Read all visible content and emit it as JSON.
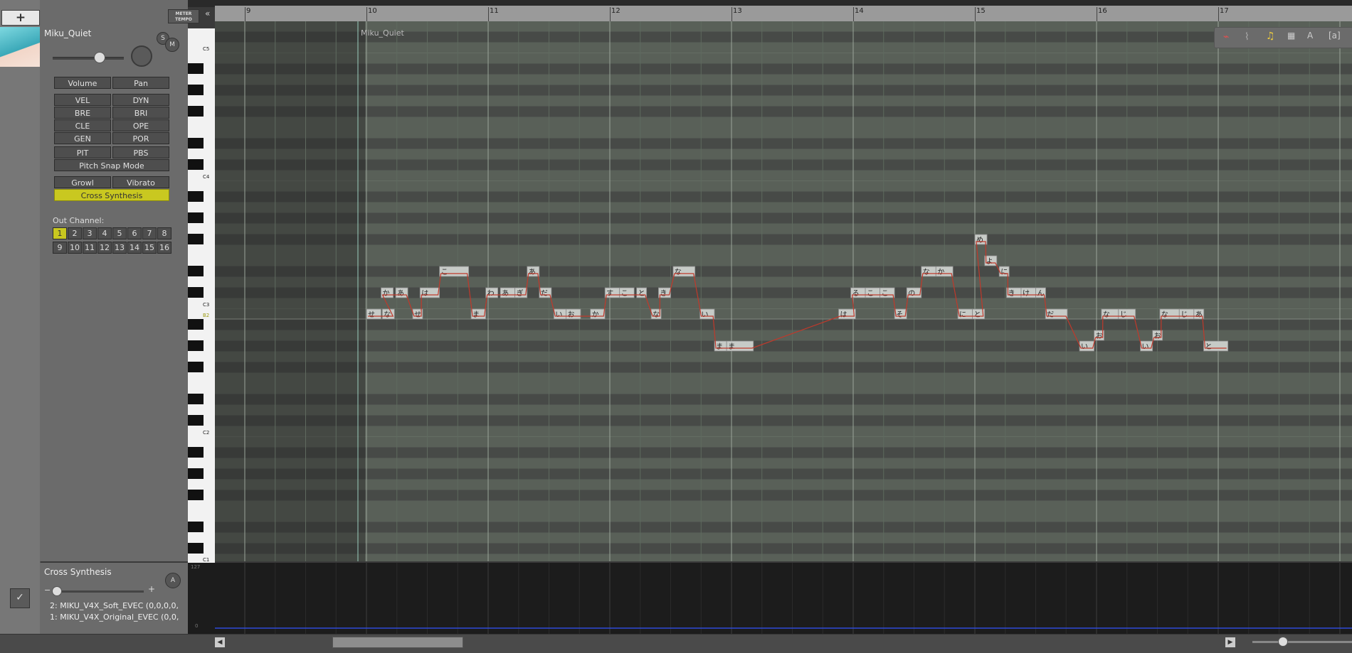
{
  "toolbar": {
    "add_label": "+",
    "meter_tempo": "METER TEMPO",
    "collapse": "«"
  },
  "track": {
    "name": "Miku_Quiet",
    "solo": "S",
    "mute": "M",
    "buttons": {
      "volume": "Volume",
      "pan": "Pan",
      "vel": "VEL",
      "dyn": "DYN",
      "bre": "BRE",
      "bri": "BRI",
      "cle": "CLE",
      "ope": "OPE",
      "gen": "GEN",
      "por": "POR",
      "pit": "PIT",
      "pbs": "PBS",
      "pitch_snap": "Pitch Snap Mode",
      "growl": "Growl",
      "vibrato": "Vibrato",
      "cross_synthesis": "Cross Synthesis"
    },
    "out_channel_label": "Out Channel:",
    "channels": [
      "1",
      "2",
      "3",
      "4",
      "5",
      "6",
      "7",
      "8",
      "9",
      "10",
      "11",
      "12",
      "13",
      "14",
      "15",
      "16"
    ],
    "selected_channel": "1"
  },
  "piano": {
    "labels": [
      "C5",
      "C4",
      "C3",
      "B2",
      "C2",
      "C1"
    ]
  },
  "ruler": {
    "bars": [
      "9",
      "10",
      "11",
      "12",
      "13",
      "14",
      "15",
      "16",
      "17"
    ]
  },
  "part": {
    "name": "Miku_Quiet"
  },
  "notes": [
    {
      "lyric": "せ",
      "pitch": "B2",
      "bar": 10.0,
      "len": 0.12
    },
    {
      "lyric": "な",
      "pitch": "B2",
      "bar": 10.13,
      "len": 0.1
    },
    {
      "lyric": "か",
      "pitch": "C#3",
      "bar": 10.12,
      "len": 0.1
    },
    {
      "lyric": "あ",
      "pitch": "C#3",
      "bar": 10.24,
      "len": 0.1
    },
    {
      "lyric": "せ",
      "pitch": "B2",
      "bar": 10.38,
      "len": 0.06
    },
    {
      "lyric": "は",
      "pitch": "C#3",
      "bar": 10.44,
      "len": 0.16
    },
    {
      "lyric": "こ",
      "pitch": "D#3",
      "bar": 10.6,
      "len": 0.24
    },
    {
      "lyric": "ま",
      "pitch": "B2",
      "bar": 10.86,
      "len": 0.12
    },
    {
      "lyric": "わ",
      "pitch": "C#3",
      "bar": 10.98,
      "len": 0.1
    },
    {
      "lyric": "あ",
      "pitch": "C#3",
      "bar": 11.1,
      "len": 0.12
    },
    {
      "lyric": "ぎ",
      "pitch": "C#3",
      "bar": 11.22,
      "len": 0.1
    },
    {
      "lyric": "あ",
      "pitch": "D#3",
      "bar": 11.32,
      "len": 0.1
    },
    {
      "lyric": "だ",
      "pitch": "C#3",
      "bar": 11.42,
      "len": 0.1
    },
    {
      "lyric": "い",
      "pitch": "B2",
      "bar": 11.54,
      "len": 0.1
    },
    {
      "lyric": "お",
      "pitch": "B2",
      "bar": 11.64,
      "len": 0.12
    },
    {
      "lyric": "か",
      "pitch": "B2",
      "bar": 11.84,
      "len": 0.12
    },
    {
      "lyric": "す",
      "pitch": "C#3",
      "bar": 11.96,
      "len": 0.12
    },
    {
      "lyric": "こ",
      "pitch": "C#3",
      "bar": 12.08,
      "len": 0.12
    },
    {
      "lyric": "と",
      "pitch": "C#3",
      "bar": 12.22,
      "len": 0.08
    },
    {
      "lyric": "な",
      "pitch": "B2",
      "bar": 12.34,
      "len": 0.06
    },
    {
      "lyric": "き",
      "pitch": "C#3",
      "bar": 12.4,
      "len": 0.1
    },
    {
      "lyric": "な",
      "pitch": "D#3",
      "bar": 12.52,
      "len": 0.18
    },
    {
      "lyric": "い",
      "pitch": "B2",
      "bar": 12.74,
      "len": 0.12
    },
    {
      "lyric": "ま",
      "pitch": "G#2",
      "bar": 12.86,
      "len": 0.1
    },
    {
      "lyric": "ま",
      "pitch": "G#2",
      "bar": 12.96,
      "len": 0.22
    },
    {
      "lyric": "は",
      "pitch": "B2",
      "bar": 13.88,
      "len": 0.14
    },
    {
      "lyric": "る",
      "pitch": "C#3",
      "bar": 13.98,
      "len": 0.12
    },
    {
      "lyric": "こ",
      "pitch": "C#3",
      "bar": 14.1,
      "len": 0.12
    },
    {
      "lyric": "こ",
      "pitch": "C#3",
      "bar": 14.22,
      "len": 0.12
    },
    {
      "lyric": "そ",
      "pitch": "B2",
      "bar": 14.34,
      "len": 0.1
    },
    {
      "lyric": "の",
      "pitch": "C#3",
      "bar": 14.44,
      "len": 0.12
    },
    {
      "lyric": "な",
      "pitch": "D#3",
      "bar": 14.56,
      "len": 0.12
    },
    {
      "lyric": "か",
      "pitch": "D#3",
      "bar": 14.68,
      "len": 0.14
    },
    {
      "lyric": "に",
      "pitch": "B2",
      "bar": 14.86,
      "len": 0.12
    },
    {
      "lyric": "と",
      "pitch": "B2",
      "bar": 14.98,
      "len": 0.1
    },
    {
      "lyric": "め",
      "pitch": "F#3",
      "bar": 15.0,
      "len": 0.1
    },
    {
      "lyric": "よ",
      "pitch": "E3",
      "bar": 15.08,
      "len": 0.1
    },
    {
      "lyric": "に",
      "pitch": "D#3",
      "bar": 15.2,
      "len": 0.06
    },
    {
      "lyric": "き",
      "pitch": "C#3",
      "bar": 15.26,
      "len": 0.12
    },
    {
      "lyric": "け",
      "pitch": "C#3",
      "bar": 15.38,
      "len": 0.12
    },
    {
      "lyric": "ん",
      "pitch": "C#3",
      "bar": 15.5,
      "len": 0.06
    },
    {
      "lyric": "だ",
      "pitch": "B2",
      "bar": 15.58,
      "len": 0.18
    },
    {
      "lyric": "い",
      "pitch": "G#2",
      "bar": 15.86,
      "len": 0.12
    },
    {
      "lyric": "お",
      "pitch": "A2",
      "bar": 15.98,
      "len": 0.06
    },
    {
      "lyric": "な",
      "pitch": "B2",
      "bar": 16.04,
      "len": 0.14
    },
    {
      "lyric": "じ",
      "pitch": "B2",
      "bar": 16.18,
      "len": 0.14
    },
    {
      "lyric": "い",
      "pitch": "G#2",
      "bar": 16.36,
      "len": 0.1
    },
    {
      "lyric": "お",
      "pitch": "A2",
      "bar": 16.46,
      "len": 0.06
    },
    {
      "lyric": "な",
      "pitch": "B2",
      "bar": 16.52,
      "len": 0.16
    },
    {
      "lyric": "じ",
      "pitch": "B2",
      "bar": 16.68,
      "len": 0.12
    },
    {
      "lyric": "あ",
      "pitch": "B2",
      "bar": 16.8,
      "len": 0.06
    },
    {
      "lyric": "と",
      "pitch": "G#2",
      "bar": 16.88,
      "len": 0.2
    }
  ],
  "control": {
    "title": "Cross Synthesis",
    "auto": "A",
    "minus": "−",
    "plus": "+",
    "voicebanks": [
      "2: MIKU_V4X_Soft_EVEC (0,0,0,0,",
      "1: MIKU_V4X_Original_EVEC (0,0,"
    ],
    "max": "127",
    "min": "0"
  },
  "colors": {
    "accent": "#c9c820",
    "pitch_line": "#c0392b",
    "grid_dark": "#4a4a4a",
    "grid_light": "#5a5a5a"
  }
}
